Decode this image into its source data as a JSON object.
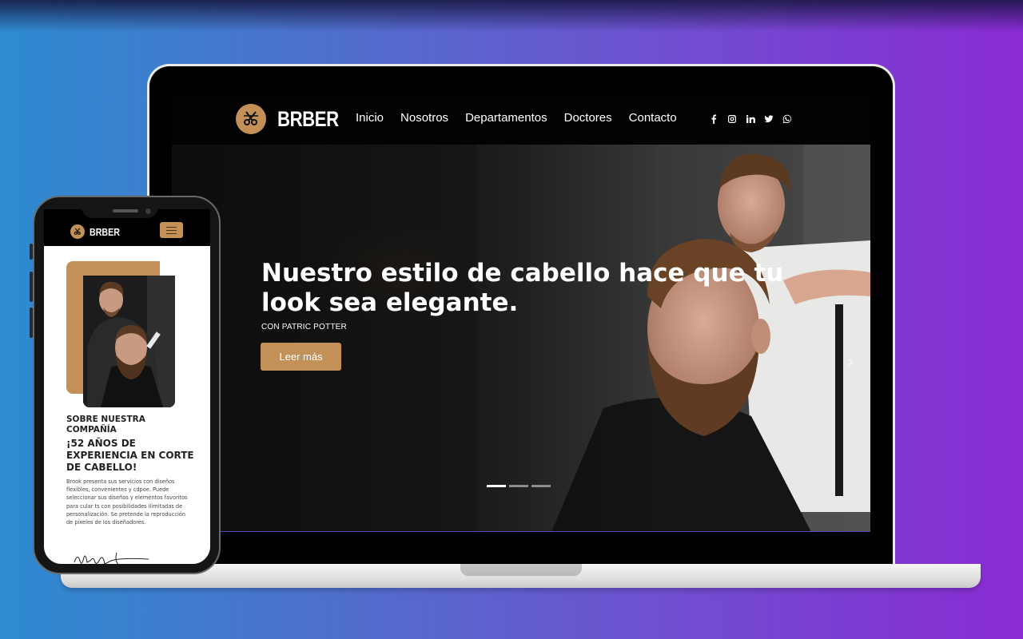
{
  "site": {
    "brand": "BRBER",
    "accent_color": "#c39158",
    "nav": [
      "Inicio",
      "Nosotros",
      "Departamentos",
      "Doctores",
      "Contacto"
    ],
    "social_icons": [
      "facebook-icon",
      "instagram-icon",
      "linkedin-icon",
      "twitter-icon",
      "whatsapp-icon"
    ]
  },
  "hero": {
    "title": "Nuestro estilo de cabello hace que tu look sea elegante.",
    "subtitle": "CON PATRIC POTTER",
    "button_label": "Leer más",
    "slides_total": 3,
    "active_slide": 1
  },
  "mobile": {
    "brand": "BRBER",
    "about_heading": "SOBRE NUESTRA COMPAÑÍA",
    "about_title": "¡52 AÑOS DE EXPERIENCIA EN CORTE DE CABELLO!",
    "about_body": "Brook presenta sus servicios con diseños flexibles, convenientes y cdpoe. Puede seleccionar sus diseños y elementos favoritos para cular ts con posibilidades ilimitadas de personalización. Se pretende la reproducción de píxeles de los diseñadores."
  }
}
